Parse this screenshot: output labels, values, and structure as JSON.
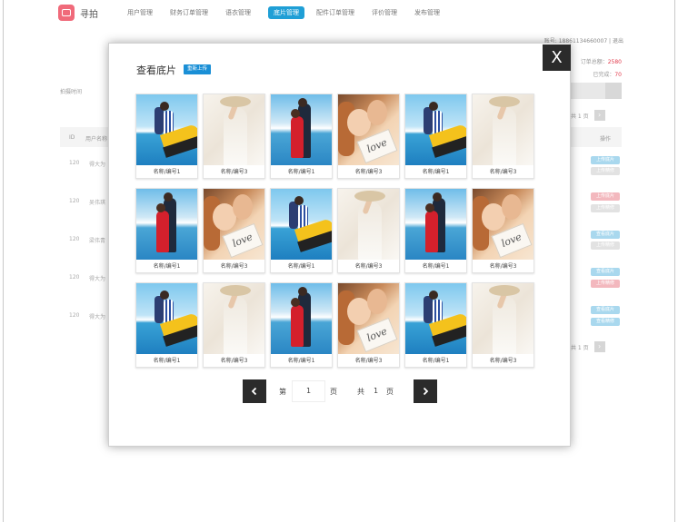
{
  "app": {
    "logo_text": "寻拍",
    "nav": [
      "用户管理",
      "财务订单管理",
      "语衣管理",
      "底片管理",
      "配件订单管理",
      "评价管理",
      "发布管理"
    ],
    "nav_active_index": 3,
    "user_info": "账号: 18861134660007 | 退出",
    "stats": {
      "line1_label": "订单总额：",
      "line1_value": "2580",
      "line2_label": "已完成：",
      "line2_value": "70"
    },
    "filter_label": "拍摄时间",
    "pager_top": "共 1 页",
    "table": {
      "headers": [
        "ID",
        "用户名称",
        "操作"
      ],
      "rows": [
        {
          "id": "120",
          "name": "得大为",
          "ops": [
            {
              "label": "上传底片",
              "type": "blue"
            },
            {
              "label": "上传精修",
              "type": "grey"
            }
          ]
        },
        {
          "id": "120",
          "name": "吴伟琪",
          "ops": [
            {
              "label": "上传底片",
              "type": "red"
            },
            {
              "label": "上传精修",
              "type": "grey"
            }
          ]
        },
        {
          "id": "120",
          "name": "梁伟青",
          "ops": [
            {
              "label": "查看底片",
              "type": "blue"
            },
            {
              "label": "上传精修",
              "type": "grey"
            }
          ]
        },
        {
          "id": "120",
          "name": "得大为",
          "ops": [
            {
              "label": "查看底片",
              "type": "blue"
            },
            {
              "label": "上传精修",
              "type": "red"
            }
          ]
        },
        {
          "id": "120",
          "name": "得大为",
          "ops": [
            {
              "label": "查看底片",
              "type": "blue"
            },
            {
              "label": "查看精修",
              "type": "blue"
            }
          ]
        }
      ]
    },
    "pager_bottom": "共 1 页"
  },
  "modal": {
    "title": "查看底片",
    "reupload_label": "重新上传",
    "close_label": "X",
    "photos": [
      {
        "caption": "名称/编号1",
        "type": "A"
      },
      {
        "caption": "名称/编号3",
        "type": "B"
      },
      {
        "caption": "名称/编号1",
        "type": "C"
      },
      {
        "caption": "名称/编号3",
        "type": "D"
      },
      {
        "caption": "名称/编号1",
        "type": "A"
      },
      {
        "caption": "名称/编号3",
        "type": "B"
      },
      {
        "caption": "名称/编号1",
        "type": "C"
      },
      {
        "caption": "名称/编号3",
        "type": "D"
      },
      {
        "caption": "名称/编号1",
        "type": "A"
      },
      {
        "caption": "名称/编号3",
        "type": "B"
      },
      {
        "caption": "名称/编号1",
        "type": "C"
      },
      {
        "caption": "名称/编号3",
        "type": "D"
      },
      {
        "caption": "名称/编号1",
        "type": "A"
      },
      {
        "caption": "名称/编号3",
        "type": "B"
      },
      {
        "caption": "名称/编号1",
        "type": "C"
      },
      {
        "caption": "名称/编号3",
        "type": "D"
      },
      {
        "caption": "名称/编号1",
        "type": "A"
      },
      {
        "caption": "名称/编号3",
        "type": "B"
      }
    ],
    "love_text": "love",
    "pagination": {
      "prev_icon": "chevron-left-icon",
      "next_icon": "chevron-right-icon",
      "page_prefix": "第",
      "page_value": "1",
      "page_suffix": "页",
      "total_prefix": "共",
      "total_value": "1",
      "total_suffix": "页"
    }
  },
  "colors": {
    "accent": "#1f9fd6",
    "danger": "#e23b4c",
    "dark_button": "#2b2b2b"
  }
}
